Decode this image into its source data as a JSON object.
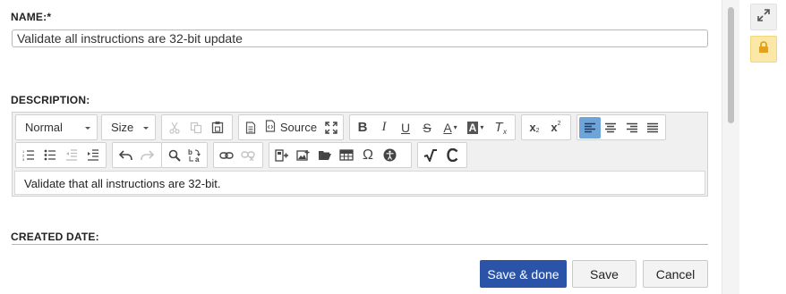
{
  "form": {
    "name_label": "NAME:*",
    "name_value": "Validate all instructions are 32-bit update",
    "description_label": "DESCRIPTION:",
    "created_date_label": "CREATED DATE:"
  },
  "editor": {
    "format_combo": "Normal",
    "size_combo": "Size",
    "source_label": "Source",
    "content": "Validate that all instructions are 32-bit.",
    "toolbar_row1": [
      "cut-icon",
      "copy-icon",
      "paste-icon",
      "document-icon",
      "source-icon",
      "maximize-icon",
      "bold-icon",
      "italic-icon",
      "underline-icon",
      "strikethrough-icon",
      "text-color-icon",
      "background-color-icon",
      "remove-format-icon",
      "subscript-icon",
      "superscript-icon",
      "align-left-icon",
      "align-center-icon",
      "align-right-icon",
      "justify-icon"
    ],
    "toolbar_row2": [
      "numbered-list-icon",
      "bulleted-list-icon",
      "outdent-icon",
      "indent-icon",
      "undo-icon",
      "redo-icon",
      "find-icon",
      "replace-icon",
      "link-icon",
      "unlink-icon",
      "insert-macro-icon",
      "insert-image-icon",
      "open-folder-icon",
      "table-icon",
      "special-char-icon",
      "accessibility-icon",
      "math-icon",
      "cleanup-icon"
    ],
    "bold_glyph": "B",
    "italic_glyph": "I",
    "underline_glyph": "U",
    "strike_glyph": "S",
    "text_color_glyph": "A",
    "bg_color_glyph": "A",
    "clear_format_glyph": "T",
    "omega_glyph": "Ω"
  },
  "buttons": {
    "save_done": "Save & done",
    "save": "Save",
    "cancel": "Cancel"
  },
  "colors": {
    "primary": "#2b54a9",
    "active_tool": "#6fa4d8",
    "lock_bg": "#fbe7a8",
    "lock_icon": "#e2a11b"
  }
}
